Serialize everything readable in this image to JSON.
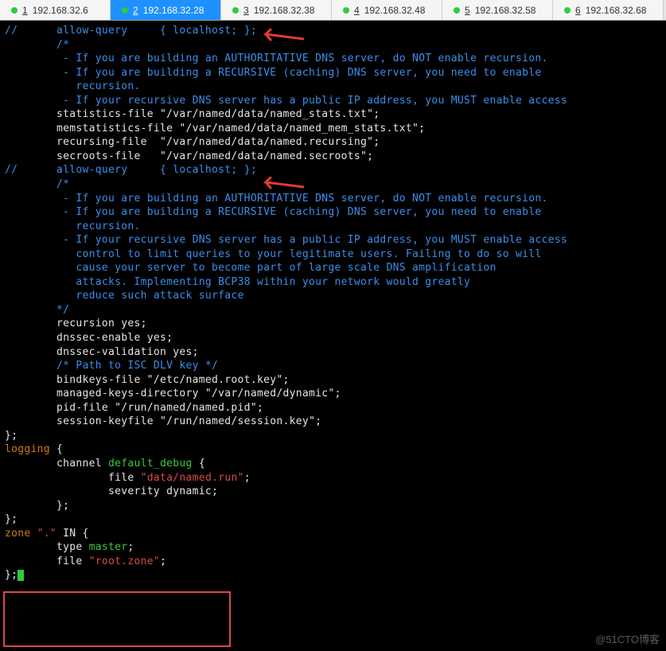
{
  "tabs": [
    {
      "num": "1",
      "ip": "192.168.32.6",
      "active": false
    },
    {
      "num": "2",
      "ip": "192.168.32.28",
      "active": true
    },
    {
      "num": "3",
      "ip": "192.168.32.38",
      "active": false
    },
    {
      "num": "4",
      "ip": "192.168.32.48",
      "active": false
    },
    {
      "num": "5",
      "ip": "192.168.32.58",
      "active": false
    },
    {
      "num": "6",
      "ip": "192.168.32.68",
      "active": false
    }
  ],
  "lines": {
    "l01a": "//      ",
    "l01b": "allow-query     { localhost; };",
    "l02": "",
    "l03": "        /*",
    "l04": "         - If you are building an AUTHORITATIVE DNS server, do NOT enable recursion.",
    "l05": "         - If you are building a RECURSIVE (caching) DNS server, you need to enable",
    "l06": "           recursion.",
    "l07": "         - If your recursive DNS server has a public IP address, you MUST enable access",
    "l08": "        statistics-file \"/var/named/data/named_stats.txt\";",
    "l09": "        memstatistics-file \"/var/named/data/named_mem_stats.txt\";",
    "l10": "        recursing-file  \"/var/named/data/named.recursing\";",
    "l11": "        secroots-file   \"/var/named/data/named.secroots\";",
    "l12a": "//      ",
    "l12b": "allow-query     { localhost; };",
    "l13": "",
    "l14": "        /*",
    "l15": "         - If you are building an AUTHORITATIVE DNS server, do NOT enable recursion.",
    "l16": "         - If you are building a RECURSIVE (caching) DNS server, you need to enable",
    "l17": "           recursion.",
    "l18": "         - If your recursive DNS server has a public IP address, you MUST enable access",
    "l19": "           control to limit queries to your legitimate users. Failing to do so will",
    "l20": "           cause your server to become part of large scale DNS amplification",
    "l21": "           attacks. Implementing BCP38 within your network would greatly",
    "l22": "           reduce such attack surface",
    "l23": "        */",
    "l24": "        recursion yes;",
    "l25": "",
    "l26": "        dnssec-enable yes;",
    "l27": "        dnssec-validation yes;",
    "l28": "",
    "l29": "        /* Path to ISC DLV key */",
    "l30": "        bindkeys-file \"/etc/named.root.key\";",
    "l31": "",
    "l32": "        managed-keys-directory \"/var/named/dynamic\";",
    "l33": "",
    "l34": "        pid-file \"/run/named/named.pid\";",
    "l35": "        session-keyfile \"/run/named/session.key\";",
    "l36": "};",
    "l37": "",
    "l38a": "logging",
    "l38b": " {",
    "l39a": "        channel ",
    "l39b": "default_debug",
    "l39c": " {",
    "l40a": "                file ",
    "l40b": "\"data/named.run\"",
    "l40c": ";",
    "l41a": "                severity",
    "l41b": " dynamic;",
    "l42": "        };",
    "l43": "};",
    "l44": "",
    "l45a": "zone ",
    "l45b": "\".\"",
    "l45c": " IN {",
    "l46a": "        type ",
    "l46b": "master",
    "l46c": ";",
    "l47a": "        file ",
    "l47b": "\"root.zone\"",
    "l47c": ";",
    "l48": "};"
  },
  "watermark": "@51CTO博客",
  "colors": {
    "comment_blue": "#3b8eea",
    "text_white": "#e5e5e5",
    "keyword_orange": "#d67b0d",
    "identifier_green": "#3ac93a",
    "string_red": "#d84a4a",
    "tab_active": "#1e90ff",
    "cursor_green": "#2ecc40"
  }
}
